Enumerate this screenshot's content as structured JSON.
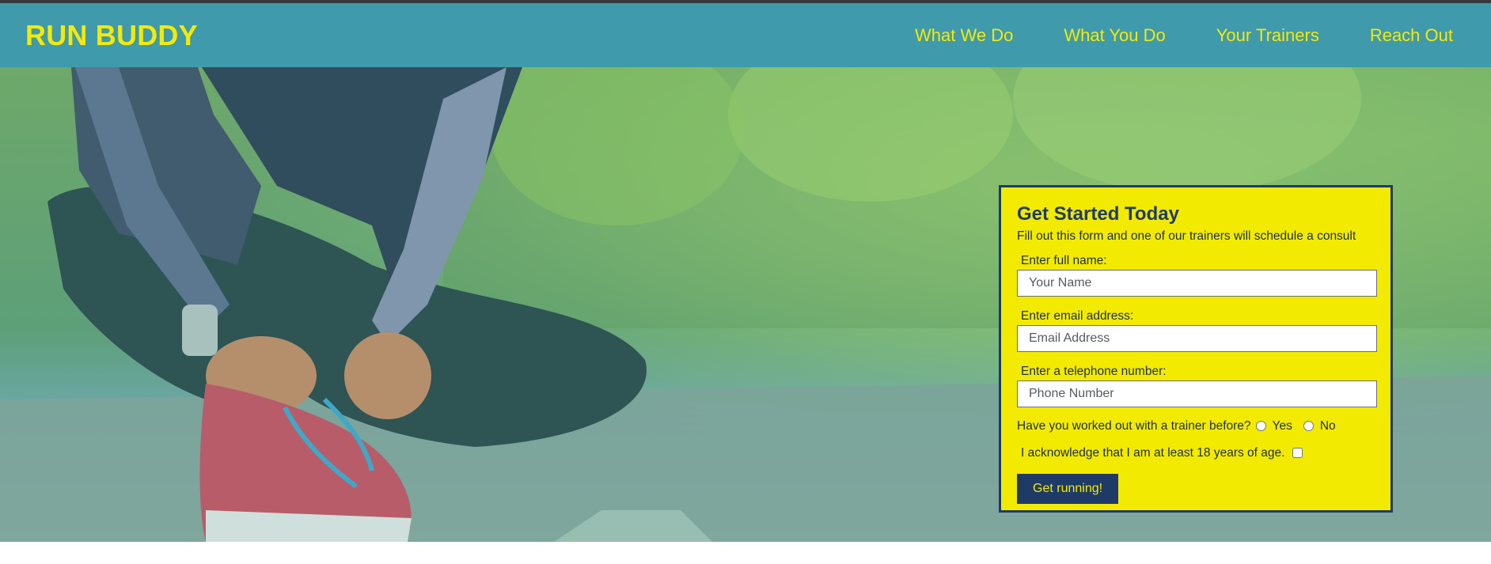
{
  "header": {
    "brand": "RUN BUDDY",
    "nav": [
      {
        "label": "What We Do"
      },
      {
        "label": "What You Do"
      },
      {
        "label": "Your Trainers"
      },
      {
        "label": "Reach Out"
      }
    ]
  },
  "hero": {
    "image_description": "runner tying shoelaces on a wooded road"
  },
  "form": {
    "title": "Get Started Today",
    "subtitle": "Fill out this form and one of our trainers will schedule a consult",
    "name_label": "Enter full name:",
    "name_placeholder": "Your Name",
    "email_label": "Enter email address:",
    "email_placeholder": "Email Address",
    "phone_label": "Enter a telephone number:",
    "phone_placeholder": "Phone Number",
    "trainer_question": "Have you worked out with a trainer before?",
    "option_yes": "Yes",
    "option_no": "No",
    "age_ack": "I acknowledge that I am at least 18 years of age.",
    "submit_label": "Get running!"
  },
  "colors": {
    "header_bg": "#3f9aab",
    "accent_yellow": "#f2ea00",
    "navy": "#1f3a67"
  }
}
